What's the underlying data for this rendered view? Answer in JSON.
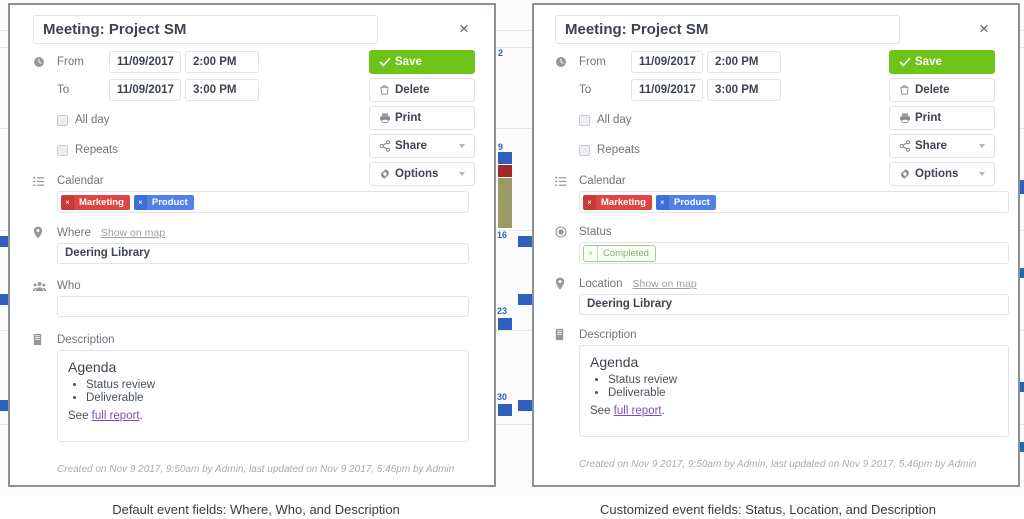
{
  "panels": [
    {
      "id": "default",
      "title_value": "Meeting: Project SM",
      "title_placeholder": "Event title",
      "close_label": "×",
      "from_label": "From",
      "to_label": "To",
      "from_date": "11/09/2017",
      "from_time": "2:00 PM",
      "to_date": "11/09/2017",
      "to_time": "3:00 PM",
      "allday_label": "All day",
      "repeats_label": "Repeats",
      "calendar_label": "Calendar",
      "calendar_chips": [
        {
          "name": "Marketing",
          "remove": "×",
          "color": "#e04545",
          "style": "red"
        },
        {
          "name": "Product",
          "remove": "×",
          "color": "#4f81e8",
          "style": "blue"
        }
      ],
      "where_label": "Where",
      "show_on_map_label": "Show on map",
      "where_value": "Deering Library",
      "who_label": "Who",
      "who_value": "",
      "description_label": "Description",
      "description_heading": "Agenda",
      "description_bullets": [
        "Status review",
        "Deliverable"
      ],
      "description_prefix": "See ",
      "description_link": "full report",
      "description_suffix": ".",
      "meta": "Created on Nov 9 2017, 9:50am by Admin, last updated on Nov 9 2017, 5:46pm by Admin",
      "actions": [
        {
          "label": "Save",
          "icon": "check-icon",
          "primary": true,
          "caret": false
        },
        {
          "label": "Delete",
          "icon": "trash-icon",
          "primary": false,
          "caret": false
        },
        {
          "label": "Print",
          "icon": "printer-icon",
          "primary": false,
          "caret": false
        },
        {
          "label": "Share",
          "icon": "share-icon",
          "primary": false,
          "caret": true
        },
        {
          "label": "Options",
          "icon": "gear-icon",
          "primary": false,
          "caret": true
        }
      ],
      "caption": "Default event fields: Where, Who, and Description"
    },
    {
      "id": "customized",
      "title_value": "Meeting: Project SM",
      "title_placeholder": "Event title",
      "close_label": "×",
      "from_label": "From",
      "to_label": "To",
      "from_date": "11/09/2017",
      "from_time": "2:00 PM",
      "to_date": "11/09/2017",
      "to_time": "3:00 PM",
      "allday_label": "All day",
      "repeats_label": "Repeats",
      "calendar_label": "Calendar",
      "calendar_chips": [
        {
          "name": "Marketing",
          "remove": "×",
          "color": "#e04545",
          "style": "red"
        },
        {
          "name": "Product",
          "remove": "×",
          "color": "#4f81e8",
          "style": "blue"
        }
      ],
      "status_label": "Status",
      "status_chip": {
        "name": "Completed",
        "remove": "×",
        "color": "#7fb35f",
        "style": "outline"
      },
      "location_label": "Location",
      "show_on_map_label": "Show on map",
      "location_value": "Deering Library",
      "description_label": "Description",
      "description_heading": "Agenda",
      "description_bullets": [
        "Status review",
        "Deliverable"
      ],
      "description_prefix": "See ",
      "description_link": "full report",
      "description_suffix": ".",
      "meta": "Created on Nov 9 2017, 9:50am by Admin, last updated on Nov 9 2017, 5:46pm by Admin",
      "actions": [
        {
          "label": "Save",
          "icon": "check-icon",
          "primary": true,
          "caret": false
        },
        {
          "label": "Delete",
          "icon": "trash-icon",
          "primary": false,
          "caret": false
        },
        {
          "label": "Print",
          "icon": "printer-icon",
          "primary": false,
          "caret": false
        },
        {
          "label": "Share",
          "icon": "share-icon",
          "primary": false,
          "caret": true
        },
        {
          "label": "Options",
          "icon": "gear-icon",
          "primary": false,
          "caret": true
        }
      ],
      "caption": "Customized event fields: Status, Location, and Description"
    }
  ],
  "colors": {
    "save_green": "#6ec318",
    "chip_red": "#e04545",
    "chip_blue": "#4f81e8",
    "chip_green": "#7fb35f",
    "link_purple": "#7a4fb5",
    "panel_border": "#8b9199"
  },
  "background": {
    "day_numbers": [
      "2",
      "9",
      "16",
      "23",
      "30"
    ],
    "event_bar_colors": [
      "#2f5fbf",
      "#a52828",
      "#9a9a62"
    ]
  }
}
